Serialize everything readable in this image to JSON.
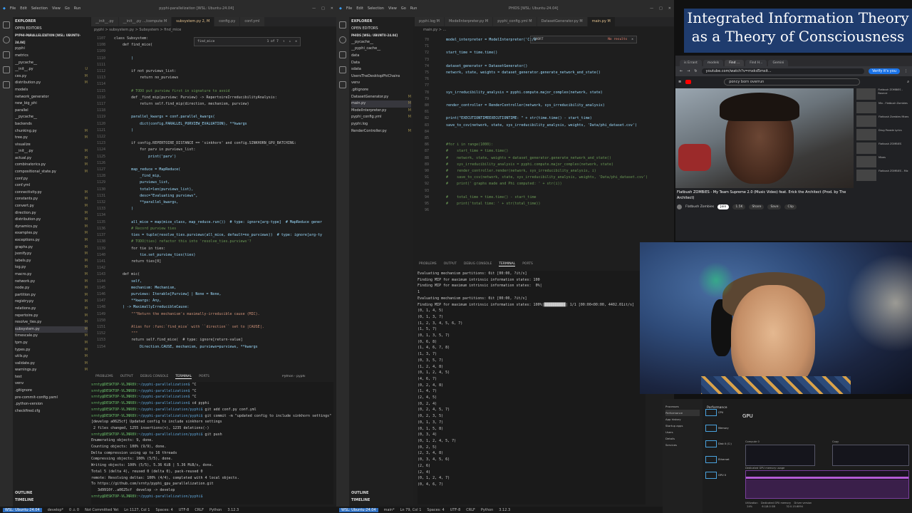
{
  "left_window": {
    "menu": [
      "File",
      "Edit",
      "Selection",
      "View",
      "Go",
      "Run"
    ],
    "title": "pyphi-parallelization [WSL: Ubuntu-24.04]",
    "explorer_header": "EXPLORER",
    "open_editors": "OPEN EDITORS",
    "project": "PYPHI-PARALLELIZATION [WSL: UBUNTU-24.04]",
    "files": [
      {
        "name": "pyphi",
        "mark": ""
      },
      {
        "name": "metrics",
        "mark": ""
      },
      {
        "name": "__pycache__",
        "mark": ""
      },
      {
        "name": "__init__.py",
        "mark": "U"
      },
      {
        "name": "ces.py",
        "mark": "M"
      },
      {
        "name": "distribution.py",
        "mark": "M"
      },
      {
        "name": "models",
        "mark": ""
      },
      {
        "name": "network_generator",
        "mark": ""
      },
      {
        "name": "new_big_phi",
        "mark": ""
      },
      {
        "name": "parallel",
        "mark": ""
      },
      {
        "name": "__pycache__",
        "mark": ""
      },
      {
        "name": "backends",
        "mark": ""
      },
      {
        "name": "chunking.py",
        "mark": "M"
      },
      {
        "name": "tree.py",
        "mark": "M"
      },
      {
        "name": "visualize",
        "mark": ""
      },
      {
        "name": "__init__.py",
        "mark": "M"
      },
      {
        "name": "actual.py",
        "mark": "M"
      },
      {
        "name": "combinatorics.py",
        "mark": "M"
      },
      {
        "name": "compositional_state.py",
        "mark": "M"
      },
      {
        "name": "conf.py",
        "mark": ""
      },
      {
        "name": "conf.yml",
        "mark": ""
      },
      {
        "name": "connectivity.py",
        "mark": "M"
      },
      {
        "name": "constants.py",
        "mark": "M"
      },
      {
        "name": "convert.py",
        "mark": "M"
      },
      {
        "name": "direction.py",
        "mark": "M"
      },
      {
        "name": "distribution.py",
        "mark": "M"
      },
      {
        "name": "dynamics.py",
        "mark": "M"
      },
      {
        "name": "examples.py",
        "mark": "M"
      },
      {
        "name": "exceptions.py",
        "mark": "M"
      },
      {
        "name": "graphs.py",
        "mark": "M"
      },
      {
        "name": "jsonify.py",
        "mark": "M"
      },
      {
        "name": "labels.py",
        "mark": "M"
      },
      {
        "name": "log.py",
        "mark": "M"
      },
      {
        "name": "macro.py",
        "mark": "M"
      },
      {
        "name": "network.py",
        "mark": "M"
      },
      {
        "name": "node.py",
        "mark": "M"
      },
      {
        "name": "partition.py",
        "mark": "M"
      },
      {
        "name": "registry.py",
        "mark": "M"
      },
      {
        "name": "relations.py",
        "mark": "M"
      },
      {
        "name": "repertoire.py",
        "mark": "M"
      },
      {
        "name": "resolve_ties.py",
        "mark": "M"
      },
      {
        "name": "subsystem.py",
        "mark": "M"
      },
      {
        "name": "timescale.py",
        "mark": "M"
      },
      {
        "name": "tpm.py",
        "mark": "M"
      },
      {
        "name": "types.py",
        "mark": "M"
      },
      {
        "name": "utils.py",
        "mark": "M"
      },
      {
        "name": "validate.py",
        "mark": "M"
      },
      {
        "name": "warnings.py",
        "mark": "M"
      },
      {
        "name": "test",
        "mark": ""
      },
      {
        "name": "venv",
        "mark": ""
      },
      {
        "name": ".gitignore",
        "mark": ""
      },
      {
        "name": "pre-commit-config.yaml",
        "mark": ""
      },
      {
        "name": ".python-version",
        "mark": ""
      },
      {
        "name": "checkfired.cfg",
        "mark": ""
      }
    ],
    "outline": "OUTLINE",
    "timeline": "TIMELINE",
    "tabs": [
      "__init__.py",
      "__init__.py .../compute M",
      "subsystem.py 2, M",
      "config.py",
      "conf.yml"
    ],
    "active_tab": 2,
    "breadcrumb": "pyphi > subsystem.py > Subsystem > find_mice",
    "find": {
      "query": "find_mice",
      "count": "1 of 7"
    },
    "code": [
      {
        "n": "1107",
        "t": "class Subsystem:"
      },
      {
        "n": "1108",
        "t": "    def find_mice("
      },
      {
        "n": "1109",
        "t": ""
      },
      {
        "n": "1110",
        "t": "        )"
      },
      {
        "n": "1111",
        "t": ""
      },
      {
        "n": "1112",
        "t": "        if not purviews_list:"
      },
      {
        "n": "1113",
        "t": "            return no_purviews"
      },
      {
        "n": "1114",
        "t": ""
      },
      {
        "n": "1115",
        "t": "        # TODO put purview first in signature to avoid"
      },
      {
        "n": "1116",
        "t": "        def _find_mip(purview: Purview) -> RepertoireIrreducibilityAnalysis:"
      },
      {
        "n": "1117",
        "t": "            return self.find_mip(direction, mechanism, purview)"
      },
      {
        "n": "1118",
        "t": ""
      },
      {
        "n": "1119",
        "t": "        parallel_kwargs = conf.parallel_kwargs("
      },
      {
        "n": "1120",
        "t": "            dict(config.PARALLEL_PURVIEW_EVALUATION), **kwargs"
      },
      {
        "n": "1121",
        "t": "        )"
      },
      {
        "n": "1122",
        "t": ""
      },
      {
        "n": "1123",
        "t": "        if config.REPERTOIRE_DISTANCE == 'sinkhorn' and config.SINKHORN_GPU_BATCHING:"
      },
      {
        "n": "1124",
        "t": "            for parv in purviews_list:"
      },
      {
        "n": "1125",
        "t": "                print('parv')"
      },
      {
        "n": "1126",
        "t": ""
      },
      {
        "n": "1127",
        "t": "        map_reduce = MapReduce("
      },
      {
        "n": "1128",
        "t": "            _find_mip,"
      },
      {
        "n": "1129",
        "t": "            purviews_list,"
      },
      {
        "n": "1130",
        "t": "            total=len(purviews_list),"
      },
      {
        "n": "1131",
        "t": "            desc=\"Evaluating purviews\","
      },
      {
        "n": "1132",
        "t": "            **parallel_kwargs,"
      },
      {
        "n": "1133",
        "t": "        )"
      },
      {
        "n": "1134",
        "t": ""
      },
      {
        "n": "1135",
        "t": "        all_mice = map(mice_class, map_reduce.run())  # type: ignore[arg-type]  # MapReduce gener"
      },
      {
        "n": "1136",
        "t": "        # Record purview ties"
      },
      {
        "n": "1137",
        "t": "        ties = tuple(resolve_ties.purviews(all_mice, default=no_purviews))  # type: ignore[arg-ty"
      },
      {
        "n": "1138",
        "t": "        # TODO(ties) refactor this into 'resolve_ties.purviews'?"
      },
      {
        "n": "1139",
        "t": "        for tie in ties:"
      },
      {
        "n": "1140",
        "t": "            tie.set_purview_ties(ties)"
      },
      {
        "n": "1141",
        "t": "        return ties[0]"
      },
      {
        "n": "1142",
        "t": ""
      },
      {
        "n": "1143",
        "t": "    def mic("
      },
      {
        "n": "1144",
        "t": "        self,"
      },
      {
        "n": "1145",
        "t": "        mechanism: Mechanism,"
      },
      {
        "n": "1146",
        "t": "        purviews: Iterable[Purview] | None = None,"
      },
      {
        "n": "1147",
        "t": "        **kwargs: Any,"
      },
      {
        "n": "1148",
        "t": "    ) -> MaximallyIrreducibleCause:"
      },
      {
        "n": "1149",
        "t": "        \"\"\"Return the mechanism's maximally-irreducible cause (MIC)."
      },
      {
        "n": "1150",
        "t": ""
      },
      {
        "n": "1151",
        "t": "        Alias for :func:`find_mice` with ``direction`` set to |CAUSE|."
      },
      {
        "n": "1152",
        "t": "        \"\"\""
      },
      {
        "n": "1153",
        "t": "        return self.find_mice(  # type: ignore[return-value]"
      },
      {
        "n": "1154",
        "t": "            Direction.CAUSE, mechanism, purviews=purviews, **kwargs"
      }
    ],
    "panel_tabs": [
      "PROBLEMS",
      "OUTPUT",
      "DEBUG CONSOLE",
      "TERMINAL",
      "PORTS"
    ],
    "terminal_label": "Python - pyphi",
    "terminal": [
      "srnty@DESKTOP-VLJNR8V:~/pyphi-parallelization$ ^C",
      "srnty@DESKTOP-VLJNR8V:~/pyphi-parallelization$ ^C",
      "srnty@DESKTOP-VLJNR8V:~/pyphi-parallelization$ ^C",
      "srnty@DESKTOP-VLJNR8V:~/pyphi-parallelization$ cd pyphi",
      "srnty@DESKTOP-VLJNR8V:~/pyphi-parallelization/pyphi$ git add conf.py conf.yml",
      "srnty@DESKTOP-VLJNR8V:~/pyphi-parallelization/pyphi$ git commit -m \"updated config to include sinkhorn settings\"",
      "[develop a0625cf] Updated config to include sinkhorn settings",
      " 2 files changed, 1255 insertions(+), 1235 deletions(-)",
      "srnty@DESKTOP-VLJNR8V:~/pyphi-parallelization/pyphi$ git push",
      "Enumerating objects: 9, done.",
      "Counting objects: 100% (9/9), done.",
      "Delta compression using up to 16 threads",
      "Compressing objects: 100% (5/5), done.",
      "Writing objects: 100% (5/5), 5.36 KiB | 5.36 MiB/s, done.",
      "Total 5 (delta 4), reused 0 (delta 0), pack-reused 0",
      "remote: Resolving deltas: 100% (4/4), completed with 4 local objects.",
      "To https://github.com/srnty/pyphi_gpu_parallelization.git",
      "   3d9910f..a0625cf  develop -> develop",
      "srnty@DESKTOP-VLJNR8V:~/pyphi-parallelization/pyphi$ "
    ],
    "status": [
      "WSL: Ubuntu-24.04",
      "develop*",
      "0 ⚠ 0",
      "Not Committed Yet",
      "Ln 1127, Col 1",
      "Spaces: 4",
      "UTF-8",
      "CRLF",
      "Python",
      "3.12.3"
    ]
  },
  "right_window": {
    "menu": [
      "File",
      "Edit",
      "Selection",
      "View",
      "Go",
      "Run"
    ],
    "title": "PHIDS [WSL: Ubuntu-24.04]",
    "explorer_header": "EXPLORER",
    "open_editors": "OPEN EDITORS",
    "project": "PHIDS [WSL: UBUNTU-24.04]",
    "files": [
      {
        "name": "__pycache__",
        "mark": ""
      },
      {
        "name": "__pyphi_cache__",
        "mark": ""
      },
      {
        "name": "data",
        "mark": ""
      },
      {
        "name": "Data",
        "mark": ""
      },
      {
        "name": "sdata",
        "mark": ""
      },
      {
        "name": "UsersTheDesktopPhiChains",
        "mark": ""
      },
      {
        "name": "venv",
        "mark": ""
      },
      {
        "name": ".gitignore",
        "mark": ""
      },
      {
        "name": "DatasetGenerator.py",
        "mark": "M"
      },
      {
        "name": "main.py",
        "mark": "M"
      },
      {
        "name": "ModelInterpreter.py",
        "mark": "M"
      },
      {
        "name": "pyphi_config.yml",
        "mark": "M"
      },
      {
        "name": "pyphi.log",
        "mark": ""
      },
      {
        "name": "RenderController.py",
        "mark": "M"
      }
    ],
    "outline": "OUTLINE",
    "timeline": "TIMELINE",
    "tabs": [
      "pyphi.log M",
      "ModelInterpreter.py M",
      "pyphi_config.yml M",
      "DatasetGenerator.py M",
      "main.py M"
    ],
    "active_tab": 4,
    "breadcrumb": "main.py > ...",
    "code": [
      {
        "n": "70",
        "t": "    model_interpreter = ModelInterpreter('C:/U"
      },
      {
        "n": "71",
        "t": ""
      },
      {
        "n": "72",
        "t": "    start_time = time.time()"
      },
      {
        "n": "73",
        "t": ""
      },
      {
        "n": "74",
        "t": "    dataset_generator = DatasetGenerator()"
      },
      {
        "n": "75",
        "t": "    network, state, weights = dataset_generator.generate_network_and_state()"
      },
      {
        "n": "76",
        "t": ""
      },
      {
        "n": "77",
        "t": ""
      },
      {
        "n": "78",
        "t": "    sys_irreducibility_analysis = pyphi.compute.major_complex(network, state)"
      },
      {
        "n": "79",
        "t": ""
      },
      {
        "n": "80",
        "t": "    render_controller = RenderController(network, sys_irreducibility_analysis)"
      },
      {
        "n": "81",
        "t": ""
      },
      {
        "n": "82",
        "t": "    print(\"EXECUTIONTIMEEXECUTIONTIME: \" + str(time.time() - start_time)"
      },
      {
        "n": "83",
        "t": "    save_to_csv(network, state, sys_irreducibility_analysis, weights, 'Data/phi_dataset.csv')"
      },
      {
        "n": "84",
        "t": ""
      },
      {
        "n": "85",
        "t": ""
      },
      {
        "n": "86",
        "t": "    #for i in range(1000):"
      },
      {
        "n": "87",
        "t": "    #    start_time = time.time()"
      },
      {
        "n": "88",
        "t": "    #    network, state, weights = dataset_generator.generate_network_and_state()"
      },
      {
        "n": "89",
        "t": "    #    sys_irreducibility_analysis = pyphi.compute.major_complex(network, state)"
      },
      {
        "n": "90",
        "t": "    #    render_controller.render(network, sys_irreducibility_analysis, i)"
      },
      {
        "n": "91",
        "t": "    #    save_to_csv(network, state, sys_irreducibility_analysis, weights, 'Data/phi_dataset.csv')"
      },
      {
        "n": "92",
        "t": "    #    print(' graphs made and Phi computed: ' + str(i))"
      },
      {
        "n": "93",
        "t": ""
      },
      {
        "n": "94",
        "t": "    #    total_time = time.time() - start_time"
      },
      {
        "n": "95",
        "t": "    #    print('total time: ' + str(total_time))"
      },
      {
        "n": "96",
        "t": ""
      }
    ],
    "find": {
      "query": "SHORT",
      "count": "No results"
    },
    "panel_tabs": [
      "PROBLEMS",
      "OUTPUT",
      "DEBUG CONSOLE",
      "TERMINAL",
      "PORTS"
    ],
    "terminal": [
      "Evaluating mechanism partitions: 0it [00:00, ?it/s]",
      "Finding MIP for maximum intrinsic information states: 100",
      "Finding MIP for maximum intrinsic information states:  0%|",
      "1",
      "Evaluating mechanism partitions: 0it [00:00, ?it/s]",
      "Finding MIP for maximum intrinsic information states: 100%|██████████| 1/1 [00:00<00:00, 4402.01it/s]",
      "(0, 1, 4, 5)",
      "(0, 1, 3, 7)",
      "(1, 2, 3, 4, 5, 6, 7)",
      "(1, 5, 7)",
      "(0, 1, 3, 5, 7)",
      "(0, 6, 8)",
      "(1, 4, 6, 7, 8)",
      "(1, 3, 7)",
      "(0, 3, 5, 7)",
      "(1, 2, 4, 8)",
      "(0, 1, 2, 4, 5)",
      "(4, 6, 7)",
      "(0, 2, 4, 8)",
      "(1, 4, 7)",
      "(2, 4, 5)",
      "(0, 2, 4)",
      "(0, 2, 4, 5, 7)",
      "(0, 2, 3, 5)",
      "(0, 1, 3, 7)",
      "(0, 1, 5, 8)",
      "(0, 3, 4)",
      "(0, 1, 2, 4, 5, 7)",
      "(0, 2, 5)",
      "(2, 3, 4, 8)",
      "(0, 3, 4, 5, 6)",
      "(2, 6)",
      "(2, 4)",
      "(0, 1, 2, 4, 7)",
      "(0, 4, 6, 7)"
    ],
    "status": [
      "WSL: Ubuntu-24.04",
      "main*",
      "Ln 79, Col 1",
      "Spaces: 4",
      "UTF-8",
      "CRLF",
      "Python",
      "3.12.3"
    ]
  },
  "banner": {
    "line1": "Integrated Information Theory",
    "line2": "as a Theory of Consciousness"
  },
  "browser": {
    "tabs": [
      "is Errant",
      "models",
      "Find ...",
      "Find H...",
      "Gemini"
    ],
    "url": "youtube.com/watch?v=mxkd5msit...",
    "ext_label": "Verify it's you",
    "yt_search": "poncy born overrun",
    "video_title": "Flatbush ZOMBiES - My Team Supreme 2.0 (Music Video) feat. Erick the Architect (Prod. by The Architect)",
    "channel": "Flatbush Zombies",
    "subscribe": "Join",
    "actions": [
      "1.5K",
      "Share",
      "Save",
      "Clip"
    ],
    "sidebar": [
      "Flatbush ZOMBiES - Bounce",
      "Mix - Flatbush Zombies",
      "Flatbush Zombies Mixes",
      "Drug Parade Lyrics",
      "Flatbush ZOMBiES",
      "Mixes",
      "Flatbush ZOMBiES - Mix"
    ]
  },
  "taskmgr": {
    "nav": [
      "Processes",
      "Performance",
      "App history",
      "Startup apps",
      "Users",
      "Details",
      "Services"
    ],
    "active_nav": 1,
    "list": [
      "CPU",
      "Memory",
      "Disk 0 (C:)",
      "Ethernet",
      "GPU 0"
    ],
    "title": "Performance",
    "gpu_label": "GPU",
    "graph_labels": [
      "Compute 0",
      "Copy",
      "Dedicated GPU memory usage"
    ],
    "stats": "Utilization    Dedicated GPU memory    Driver version\n  24%            6.1/8.0 GB              32.0.15.6094"
  },
  "colors": {
    "accent": "#1f3c6e",
    "editor_bg": "#1e1e1e",
    "modified": "#9a8a4c",
    "status_remote": "#2f6fbf"
  }
}
